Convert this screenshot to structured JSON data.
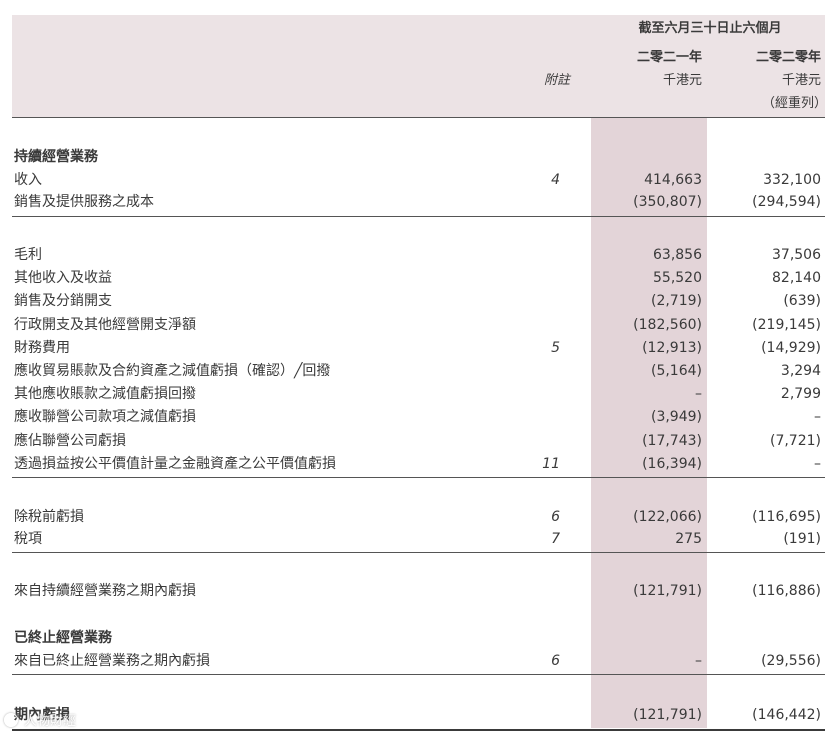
{
  "header": {
    "period": "截至六月三十日止六個月",
    "note_label": "附註",
    "col1_year": "二零二一年",
    "col2_year": "二零二零年",
    "col1_unit": "千港元",
    "col2_unit": "千港元",
    "col2_restated": "（經重列）"
  },
  "sections": {
    "continuing": "持續經營業務",
    "discontinued": "已終止經營業務"
  },
  "rows": [
    {
      "label": "收入",
      "note": "4",
      "v1": "414,663",
      "v2": "332,100"
    },
    {
      "label": "銷售及提供服務之成本",
      "note": "",
      "v1": "(350,807)",
      "v2": "(294,594)"
    },
    {
      "label": "毛利",
      "note": "",
      "v1": "63,856",
      "v2": "37,506"
    },
    {
      "label": "其他收入及收益",
      "note": "",
      "v1": "55,520",
      "v2": "82,140"
    },
    {
      "label": "銷售及分銷開支",
      "note": "",
      "v1": "(2,719)",
      "v2": "(639)"
    },
    {
      "label": "行政開支及其他經營開支淨額",
      "note": "",
      "v1": "(182,560)",
      "v2": "(219,145)"
    },
    {
      "label": "財務費用",
      "note": "5",
      "v1": "(12,913)",
      "v2": "(14,929)"
    },
    {
      "label": "應收貿易賬款及合約資產之減值虧損（確認）╱回撥",
      "note": "",
      "v1": "(5,164)",
      "v2": "3,294"
    },
    {
      "label": "其他應收賬款之減值虧損回撥",
      "note": "",
      "v1": "–",
      "v2": "2,799"
    },
    {
      "label": "應收聯營公司款項之減值虧損",
      "note": "",
      "v1": "(3,949)",
      "v2": "–"
    },
    {
      "label": "應佔聯營公司虧損",
      "note": "",
      "v1": "(17,743)",
      "v2": "(7,721)"
    },
    {
      "label": "透過損益按公平價值計量之金融資產之公平價值虧損",
      "note": "11",
      "v1": "(16,394)",
      "v2": "–"
    },
    {
      "label": "除稅前虧損",
      "note": "6",
      "v1": "(122,066)",
      "v2": "(116,695)"
    },
    {
      "label": "稅項",
      "note": "7",
      "v1": "275",
      "v2": "(191)"
    },
    {
      "label": "來自持續經營業務之期內虧損",
      "note": "",
      "v1": "(121,791)",
      "v2": "(116,886)"
    },
    {
      "label": "來自已終止經營業務之期內虧損",
      "note": "6",
      "v1": "–",
      "v2": "(29,556)"
    },
    {
      "label": "期內虧損",
      "note": "",
      "v1": "(121,791)",
      "v2": "(146,442)"
    }
  ],
  "watermark": "人物財經"
}
